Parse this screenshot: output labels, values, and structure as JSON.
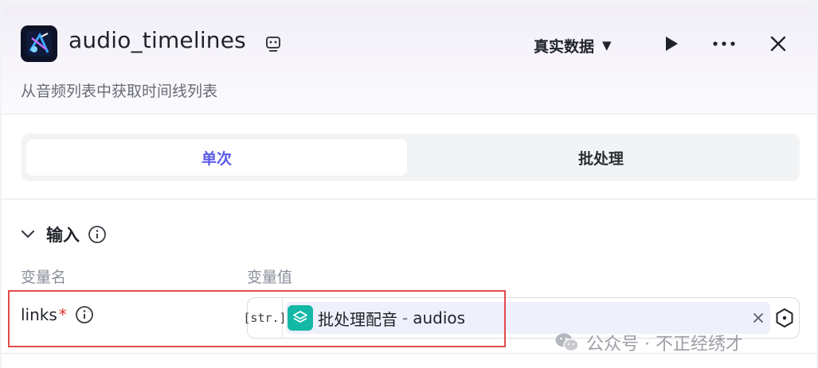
{
  "header": {
    "title": "audio_timelines",
    "subtitle": "从音频列表中获取时间线列表",
    "mode": "真实数据",
    "app_icon": "audio-visual-app-icon",
    "title_icon": "ui-view-icon",
    "actions": [
      "play-icon",
      "more-icon",
      "close-icon"
    ]
  },
  "tabs": [
    {
      "label": "单次",
      "active": true
    },
    {
      "label": "批处理",
      "active": false
    }
  ],
  "input_section": {
    "title": "输入",
    "col_name": "变量名",
    "col_value": "变量值",
    "row": {
      "name": "links",
      "required_mark": "*",
      "type": "[str.]",
      "ref_source": "批处理配音",
      "ref_sep": "-",
      "ref_field": "audios"
    }
  },
  "watermark": {
    "text": "公众号 · 不正经绣才"
  },
  "colors": {
    "accent": "#5b5be8",
    "highlight": "#e24b4b",
    "ref_icon": "#14b8a6",
    "required": "#e03131"
  }
}
